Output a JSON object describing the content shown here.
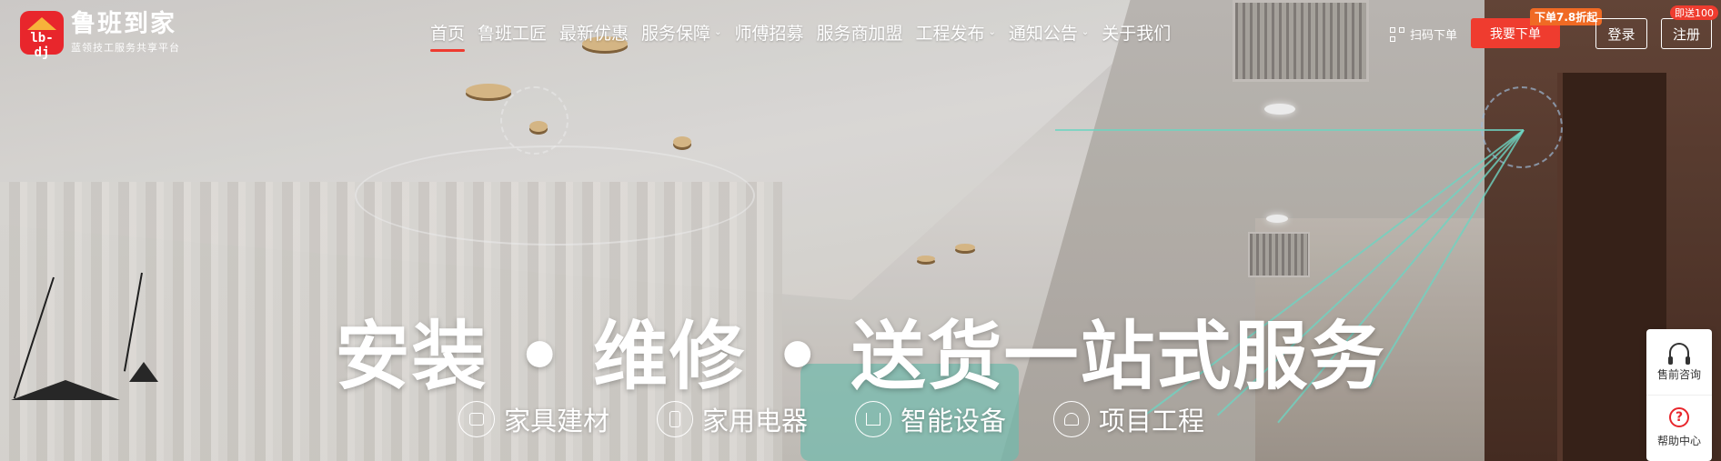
{
  "brand": {
    "logo_text": "lb-dj",
    "name": "鲁班到家",
    "tagline": "蓝领技工服务共享平台"
  },
  "nav": [
    {
      "label": "首页",
      "active": true,
      "dropdown": false
    },
    {
      "label": "鲁班工匠",
      "active": false,
      "dropdown": false
    },
    {
      "label": "最新优惠",
      "active": false,
      "dropdown": false
    },
    {
      "label": "服务保障",
      "active": false,
      "dropdown": true
    },
    {
      "label": "师傅招募",
      "active": false,
      "dropdown": false
    },
    {
      "label": "服务商加盟",
      "active": false,
      "dropdown": false
    },
    {
      "label": "工程发布",
      "active": false,
      "dropdown": true
    },
    {
      "label": "通知公告",
      "active": false,
      "dropdown": true
    },
    {
      "label": "关于我们",
      "active": false,
      "dropdown": false
    }
  ],
  "actions": {
    "scan_label": "扫码下单",
    "order_label": "我要下单",
    "order_promo": "下单7.8折起",
    "login_label": "登录",
    "register_label": "注册",
    "register_promo": "即送100"
  },
  "hero": {
    "headline": "安装 • 维修 • 送货一站式服务",
    "categories": [
      {
        "label": "家具建材",
        "icon": "sofa-icon"
      },
      {
        "label": "家用电器",
        "icon": "appliance-icon"
      },
      {
        "label": "智能设备",
        "icon": "smart-device-icon"
      },
      {
        "label": "项目工程",
        "icon": "project-icon"
      }
    ]
  },
  "side_panel": {
    "presale_label": "售前咨询",
    "help_label": "帮助中心"
  },
  "colors": {
    "accent": "#ef3c2f",
    "brand_red": "#e8262c",
    "promo_orange": "#f06a24"
  }
}
